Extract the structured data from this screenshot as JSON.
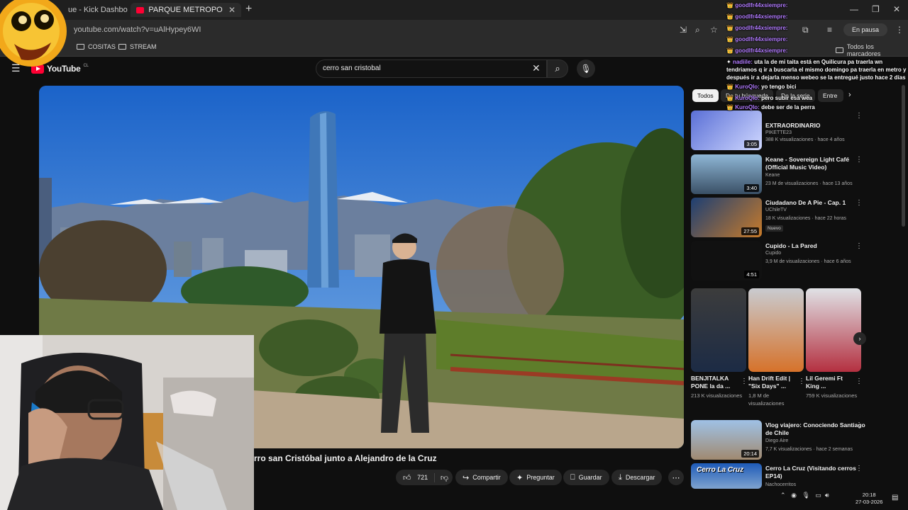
{
  "browser": {
    "tabs": [
      {
        "label": "ue - Kick Dashbo"
      },
      {
        "label": "PARQUE METROPOLITANO DE"
      }
    ],
    "url": "youtube.com/watch?v=uAlHypey6WI",
    "profile_status": "En pausa",
    "bookmarks": [
      {
        "label": "COSITAS"
      },
      {
        "label": "STREAM"
      }
    ],
    "all_bookmarks": "Todos los marcadores"
  },
  "youtube": {
    "logo_text": "YouTube",
    "logo_country": "CL",
    "search_value": "cerro san cristobal",
    "video": {
      "title": "rro san Cristóbal junto a Alejandro de la Cruz",
      "likes": "721",
      "share_label": "Compartir",
      "ask_label": "Preguntar",
      "save_label": "Guardar",
      "download_label": "Descargar"
    },
    "chips": [
      {
        "label": "Todos",
        "active": true
      },
      {
        "label": "De tu búsqueda",
        "active": false
      },
      {
        "label": "De la serie",
        "active": false
      },
      {
        "label": "Entre",
        "active": false
      }
    ],
    "recommendations": [
      {
        "title": "EXTRAORDINARIO",
        "channel": "PIKETTE23",
        "meta": "388 K visualizaciones · hace 4 años",
        "duration": "3:05"
      },
      {
        "title": "Keane - Sovereign Light Café (Official Music Video)",
        "channel": "Keane",
        "meta": "23 M de visualizaciones · hace 13 años",
        "duration": "3:40"
      },
      {
        "title": "Ciudadano De A Pie - Cap. 1",
        "channel": "UChileTV",
        "meta": "18 K visualizaciones · hace 22 horas",
        "badge": "Nuevo",
        "duration": "27:55"
      },
      {
        "title": "Cupido - La Pared",
        "channel": "Cupido",
        "meta": "3,9 M de visualizaciones · hace 6 años",
        "duration": "4:51"
      }
    ],
    "shorts": [
      {
        "title": "BENJITALKA PONE la da ...",
        "views": "213 K visualizaciones"
      },
      {
        "title": "Han Drift Edit | \"Six Days\" ...",
        "views": "1,8 M de visualizaciones"
      },
      {
        "title": "Lil Geremi Ft King ...",
        "views": "759 K visualizaciones"
      }
    ],
    "more_recommendations": [
      {
        "title": "Vlog viajero: Conociendo Santiago de Chile",
        "channel": "Diego Aire",
        "meta": "7,7 K visualizaciones · hace 2 semanas",
        "duration": "20:14"
      },
      {
        "title": "Cerro La Cruz (Visitando cerros EP14)",
        "channel": "Nachocerritos",
        "meta": "",
        "thumb_text": "Cerro La Cruz"
      }
    ]
  },
  "chat": [
    {
      "user": "goodlfr44xsiempre:",
      "text": ""
    },
    {
      "user": "goodlfr44xsiempre:",
      "text": ""
    },
    {
      "user": "goodlfr44xsiempre:",
      "text": ""
    },
    {
      "user": "goodlfr44xsiempre:",
      "text": ""
    },
    {
      "user": "goodlfr44xsiempre:",
      "text": ""
    },
    {
      "user": "nadiile:",
      "text": "uta la de mi taita está en Quilicura pa traerla wn tendriamos q ir a buscarla el mismo domingo pa traerla en metro y después ir a dejarla menso webeo se la entregué justo hace 2 días"
    },
    {
      "user": "KuroQlo:",
      "text": "yo tengo bici"
    },
    {
      "user": "KuroQlo:",
      "text": "pero subir esa wea"
    },
    {
      "user": "KuroQlo:",
      "text": "debe ser de la perra"
    }
  ],
  "taskbar": {
    "time": "20:18",
    "date": "27-03-2026"
  },
  "colors": {
    "background": "#0f0f0f",
    "accent": "#ff0033",
    "chat_user": "#b27bff"
  }
}
